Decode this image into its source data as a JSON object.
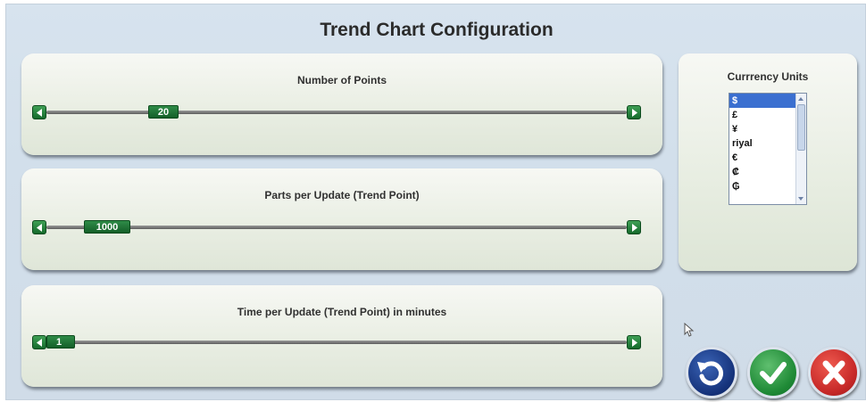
{
  "dialog": {
    "title": "Trend Chart Configuration"
  },
  "sliders": [
    {
      "label": "Number of Points",
      "value": "20"
    },
    {
      "label": "Parts per Update (Trend Point)",
      "value": "1000"
    },
    {
      "label": "Time per Update (Trend Point) in minutes",
      "value": "1"
    }
  ],
  "currency": {
    "label": "Currrency Units",
    "options": [
      "$",
      "£",
      "¥",
      "riyal",
      "€",
      "₡",
      "₲"
    ],
    "selected": "$"
  },
  "actions": {
    "undo_icon": "undo-icon",
    "confirm_icon": "checkmark-icon",
    "cancel_icon": "close-icon"
  },
  "colors": {
    "accent_green": "#1f7a35",
    "undo_blue": "#1c3f8a",
    "cancel_red": "#c62828",
    "selection_blue": "#3a6fd0"
  }
}
